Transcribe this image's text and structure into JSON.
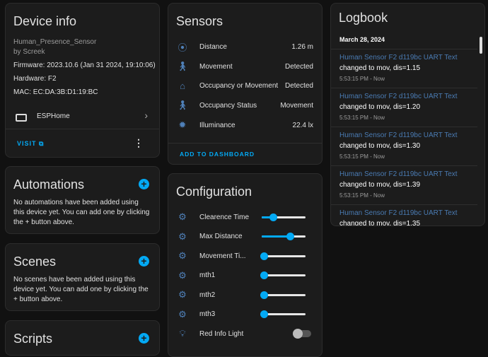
{
  "device_info": {
    "title": "Device info",
    "model": "Human_Presence_Sensor",
    "manufacturer": "by Screek",
    "firmware": "Firmware: 2023.10.6 (Jan 31 2024, 19:10:06)",
    "hardware": "Hardware: F2",
    "mac": "MAC: EC:DA:3B:D1:19:BC",
    "integration": "ESPHome",
    "visit": "VISIT"
  },
  "automations": {
    "title": "Automations",
    "text": "No automations have been added using this device yet. You can add one by clicking the + button above."
  },
  "scenes": {
    "title": "Scenes",
    "text": "No scenes have been added using this device yet. You can add one by clicking the + button above."
  },
  "scripts": {
    "title": "Scripts"
  },
  "sensors": {
    "title": "Sensors",
    "items": [
      {
        "icon": "signal-distance-icon",
        "label": "Distance",
        "value": "1.26 m"
      },
      {
        "icon": "motion-sensor-icon",
        "label": "Movement",
        "value": "Detected"
      },
      {
        "icon": "home-icon",
        "label": "Occupancy or Movement",
        "value": "Detected"
      },
      {
        "icon": "motion-sensor-icon",
        "label": "Occupancy Status",
        "value": "Movement"
      },
      {
        "icon": "brightness-icon",
        "label": "Illuminance",
        "value": "22.4 lx"
      }
    ],
    "add": "ADD TO DASHBOARD"
  },
  "configuration": {
    "title": "Configuration",
    "items": [
      {
        "label": "Clearence Time",
        "value": 25
      },
      {
        "label": "Max Distance",
        "value": 65
      },
      {
        "label": "Movement Ti...",
        "value": 2
      },
      {
        "label": "mth1",
        "value": 5
      },
      {
        "label": "mth2",
        "value": 5
      },
      {
        "label": "mth3",
        "value": 5
      }
    ],
    "light": {
      "label": "Red Info Light",
      "on": false
    }
  },
  "logbook": {
    "title": "Logbook",
    "date": "March 28, 2024",
    "entries": [
      {
        "entity": "Human Sensor F2 d119bc UART Text",
        "change": "changed to mov, dis=1.15",
        "time": "5:53:15 PM - Now"
      },
      {
        "entity": "Human Sensor F2 d119bc UART Text",
        "change": "changed to mov, dis=1.20",
        "time": "5:53:15 PM - Now"
      },
      {
        "entity": "Human Sensor F2 d119bc UART Text",
        "change": "changed to mov, dis=1.30",
        "time": "5:53:15 PM - Now"
      },
      {
        "entity": "Human Sensor F2 d119bc UART Text",
        "change": "changed to mov, dis=1.39",
        "time": "5:53:15 PM - Now"
      },
      {
        "entity": "Human Sensor F2 d119bc UART Text",
        "change": "changed to mov, dis=1.35",
        "time": ""
      }
    ]
  }
}
